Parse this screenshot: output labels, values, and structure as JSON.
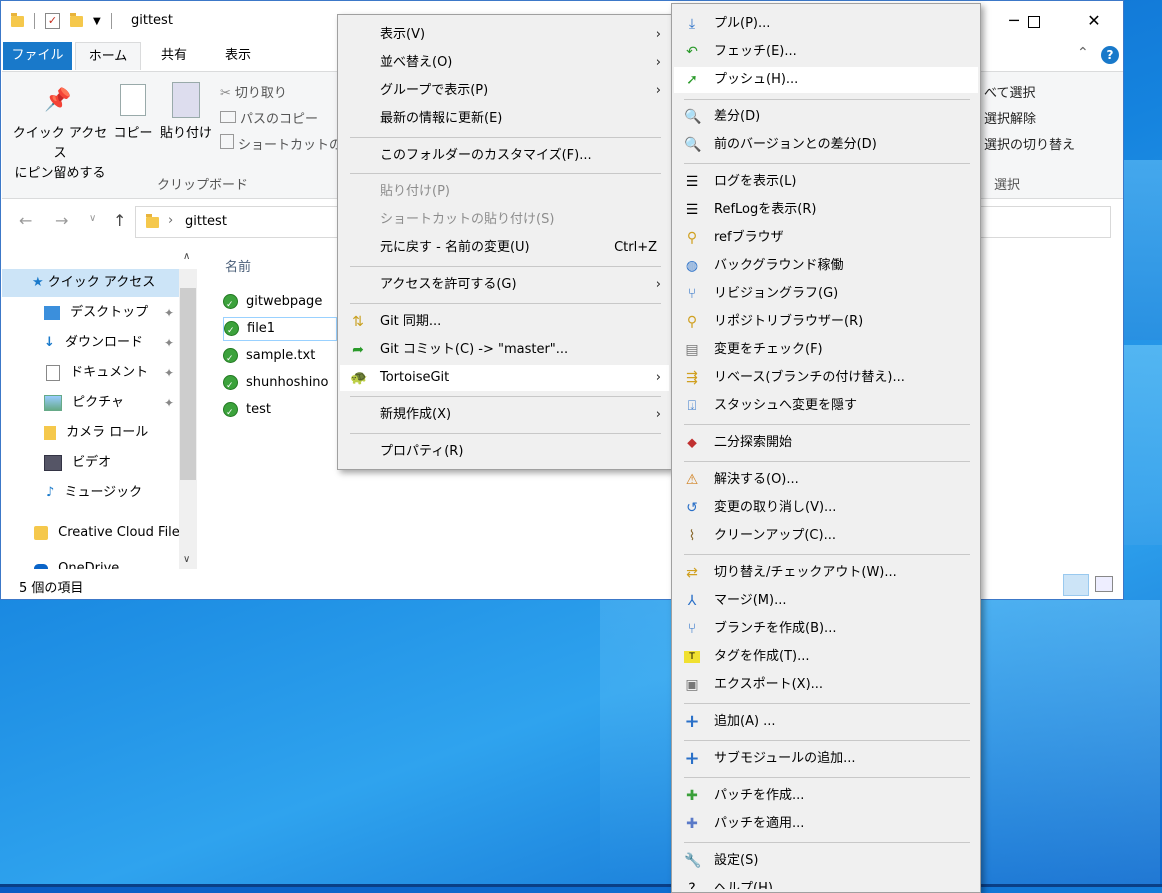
{
  "window": {
    "title": "gittest",
    "minimize_glyph": "─",
    "maximize_glyph": "☐",
    "close_glyph": "✕",
    "help_glyph": "?",
    "collapse_glyph": "⌃"
  },
  "ribbon": {
    "tab_file": "ファイル",
    "tab_home": "ホーム",
    "tab_share": "共有",
    "tab_view": "表示",
    "pin_quick_access": [
      "クイック アクセス",
      "にピン留めする"
    ],
    "copy": "コピー",
    "paste": "貼り付け",
    "cut": "切り取り",
    "copy_path": "パスのコピー",
    "paste_shortcut": "ショートカットの貼",
    "clipboard_group": "クリップボード",
    "select_all": "べて選択",
    "select_none": "選択解除",
    "invert_selection": "選択の切り替え",
    "select_group": "選択"
  },
  "address": {
    "path": "gittest"
  },
  "navpane": {
    "items": [
      {
        "label": "クイック アクセス",
        "icon": "star-icon"
      },
      {
        "label": "デスクトップ",
        "icon": "desktop-icon"
      },
      {
        "label": "ダウンロード",
        "icon": "download-icon"
      },
      {
        "label": "ドキュメント",
        "icon": "document-icon"
      },
      {
        "label": "ピクチャ",
        "icon": "picture-icon"
      },
      {
        "label": "カメラ ロール",
        "icon": "folder-icon"
      },
      {
        "label": "ビデオ",
        "icon": "video-icon"
      },
      {
        "label": "ミュージック",
        "icon": "music-icon"
      },
      {
        "label": "Creative Cloud File",
        "icon": "creative-cloud-icon"
      },
      {
        "label": "OneDrive",
        "icon": "onedrive-icon"
      }
    ]
  },
  "files": {
    "column_name": "名前",
    "items": [
      "gitwebpage",
      "file1",
      "sample.txt",
      "shunhoshino",
      "test"
    ]
  },
  "status": {
    "count": "5 個の項目"
  },
  "context_menu": {
    "view": "表示(V)",
    "sort": "並べ替え(O)",
    "group": "グループで表示(P)",
    "refresh": "最新の情報に更新(E)",
    "customize": "このフォルダーのカスタマイズ(F)...",
    "paste": "貼り付け(P)",
    "paste_shortcut": "ショートカットの貼り付け(S)",
    "undo": "元に戻す - 名前の変更(U)",
    "undo_shortcut": "Ctrl+Z",
    "give_access": "アクセスを許可する(G)",
    "git_sync": "Git 同期...",
    "git_commit": "Git コミット(C) -> \"master\"...",
    "tortoisegit": "TortoiseGit",
    "new": "新規作成(X)",
    "properties": "プロパティ(R)"
  },
  "tortoise_menu": {
    "pull": "プル(P)...",
    "fetch": "フェッチ(E)...",
    "push": "プッシュ(H)...",
    "diff": "差分(D)",
    "diff_prev": "前のバージョンとの差分(D)",
    "show_log": "ログを表示(L)",
    "reflog": "RefLogを表示(R)",
    "ref_browser": "refブラウザ",
    "daemon": "バックグラウンド稼働",
    "revision_graph": "リビジョングラフ(G)",
    "repo_browser": "リポジトリブラウザー(R)",
    "check_mods": "変更をチェック(F)",
    "rebase": "リベース(ブランチの付け替え)...",
    "stash": "スタッシュへ変更を隠す",
    "bisect": "二分探索開始",
    "resolve": "解決する(O)...",
    "revert": "変更の取り消し(V)...",
    "cleanup": "クリーンアップ(C)...",
    "switch": "切り替え/チェックアウト(W)...",
    "merge": "マージ(M)...",
    "create_branch": "ブランチを作成(B)...",
    "create_tag": "タグを作成(T)...",
    "export": "エクスポート(X)...",
    "add": "追加(A) ...",
    "submodule_add": "サブモジュールの追加...",
    "create_patch": "パッチを作成...",
    "apply_patch": "パッチを適用...",
    "settings": "設定(S)",
    "help": "ヘルプ(H)"
  }
}
